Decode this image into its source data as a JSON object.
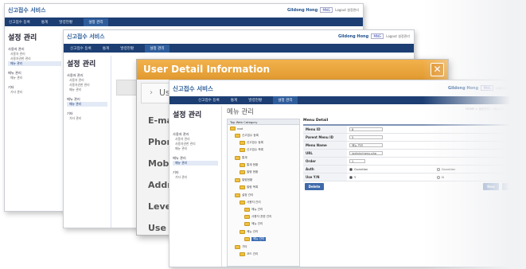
{
  "app": {
    "title": "신고접수 서비스",
    "user_name": "Gildong Hong",
    "user_btn": "MNG",
    "links": [
      "Logout",
      "설정관리"
    ]
  },
  "nav": {
    "items": [
      "신고접수 등록",
      "통계",
      "발령현황",
      "설정 관리"
    ]
  },
  "back_window": {
    "side_title": "설정 관리",
    "groups": [
      {
        "label": "사용자 관리",
        "items": [
          "사용자 관리",
          "사용자권한 관리",
          "메뉴 관리"
        ]
      },
      {
        "label": "매뉴 관리",
        "items": [
          "매뉴 관리"
        ]
      },
      {
        "label": "기타",
        "items": [
          "기타 관리"
        ]
      }
    ]
  },
  "mid_window": {
    "side_title": "설정 관리",
    "groups": [
      {
        "label": "사용자 관리",
        "items": [
          "사용자 관리",
          "사용자권한 관리",
          "메뉴 관리"
        ]
      },
      {
        "label": "매뉴 관리",
        "items": [
          "매뉴 관리"
        ]
      },
      {
        "label": "기타",
        "items": [
          "기타 관리"
        ]
      }
    ],
    "user_btn": "사용"
  },
  "modal": {
    "title": "User Detail Information",
    "close_glyph": "✕",
    "sub_title": "User",
    "fields": [
      "E-mail",
      "Phone",
      "Mobile",
      "Addre",
      "Level",
      "Use Y/"
    ]
  },
  "front": {
    "side_title": "설정 관리",
    "page_title": "메뉴 관리",
    "breadcrumb": "HOME > 설정관리 > 메뉴관리 > 메뉴 관리",
    "side_groups": [
      {
        "label": "사용자 관리",
        "items": [
          "사용자 관리",
          "사용자권한 관리",
          "메뉴 관리"
        ]
      },
      {
        "label": "매뉴 관리",
        "items": [
          "매뉴 관리"
        ]
      },
      {
        "label": "기타",
        "items": [
          "기타 관리"
        ]
      }
    ],
    "tree": {
      "header": "Top Web Category",
      "nodes": [
        "root",
        "신고접수 등록",
        "신고접수 등록",
        "신고접수 목록",
        "통계",
        "통계 현황",
        "발령 현황",
        "발령현황",
        "발령 목록",
        "설정 관리",
        "사용자 관리",
        "메뉴 관리",
        "사용자 권한 관리",
        "메뉴 관리",
        "메뉴 관리",
        "메뉴 관리",
        "기타",
        "코드 관리"
      ]
    },
    "detail": {
      "heading": "Menu Detail",
      "rows": [
        {
          "label": "Menu ID",
          "value": "8"
        },
        {
          "label": "Parent Menu ID",
          "value": "5"
        },
        {
          "label": "Menu Name",
          "value": "메뉴 관리"
        },
        {
          "label": "URL",
          "value": "/admin/menu.php"
        },
        {
          "label": "Order",
          "value": "1"
        }
      ],
      "auth_label": "Auth",
      "auth_options": [
        "Guardian",
        "Guardian"
      ],
      "use_label": "Use Y/N",
      "use_options": [
        "Y",
        "N"
      ],
      "delete_label": "Delete",
      "new_label": "New",
      "save_label": "Save"
    }
  }
}
